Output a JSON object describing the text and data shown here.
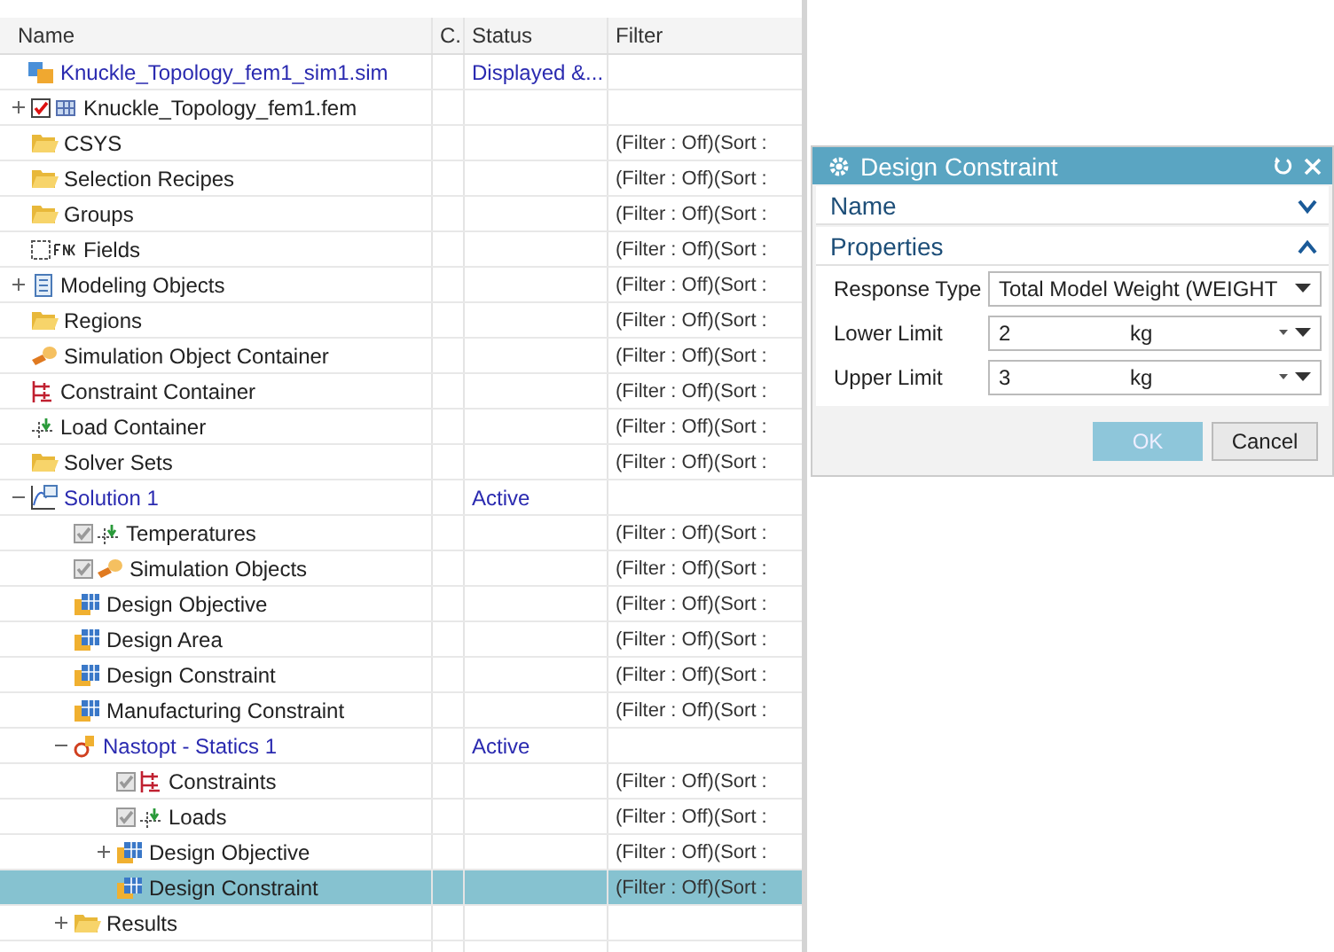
{
  "tree": {
    "columns": [
      "Name",
      "C.",
      "Status",
      "Filter"
    ],
    "nodes": [
      {
        "name": "Knuckle_Topology_fem1_sim1.sim",
        "kind": "sim",
        "status": "Displayed &...",
        "selected": false,
        "children": [
          {
            "name": "Knuckle_Topology_fem1.fem",
            "kind": "fem",
            "expanded": false,
            "checkbox": {
              "checked": true,
              "disabled": false
            },
            "selected": false
          },
          {
            "name": "CSYS",
            "kind": "folder",
            "filter": "(Filter : Off)(Sort :",
            "selected": false
          },
          {
            "name": "Selection Recipes",
            "kind": "folder",
            "filter": "(Filter : Off)(Sort :",
            "selected": false
          },
          {
            "name": "Groups",
            "kind": "folder",
            "filter": "(Filter : Off)(Sort :",
            "selected": false
          },
          {
            "name": "Fields",
            "kind": "fields",
            "checkbox": {
              "checked": false,
              "disabled": false
            },
            "filter": "(Filter : Off)(Sort :",
            "selected": false
          },
          {
            "name": "Modeling Objects",
            "kind": "modeling",
            "expanded": false,
            "filter": "(Filter : Off)(Sort :",
            "selected": false
          },
          {
            "name": "Regions",
            "kind": "folder",
            "filter": "(Filter : Off)(Sort :",
            "selected": false
          },
          {
            "name": "Simulation Object Container",
            "kind": "simobject",
            "filter": "(Filter : Off)(Sort :",
            "selected": false
          },
          {
            "name": "Constraint Container",
            "kind": "constraint",
            "filter": "(Filter : Off)(Sort :",
            "selected": false
          },
          {
            "name": "Load Container",
            "kind": "load",
            "filter": "(Filter : Off)(Sort :",
            "selected": false
          },
          {
            "name": "Solver Sets",
            "kind": "folder",
            "filter": "(Filter : Off)(Sort :",
            "selected": false
          },
          {
            "name": "Solution 1",
            "kind": "solution",
            "expanded": true,
            "status": "Active",
            "selected": false,
            "children": [
              {
                "name": "Temperatures",
                "kind": "load",
                "checkbox": {
                  "checked": true,
                  "disabled": true
                },
                "filter": "(Filter : Off)(Sort :",
                "selected": false
              },
              {
                "name": "Simulation Objects",
                "kind": "simobject",
                "checkbox": {
                  "checked": true,
                  "disabled": true
                },
                "filter": "(Filter : Off)(Sort :",
                "selected": false
              },
              {
                "name": "Design Objective",
                "kind": "design",
                "filter": "(Filter : Off)(Sort :",
                "selected": false
              },
              {
                "name": "Design Area",
                "kind": "design",
                "filter": "(Filter : Off)(Sort :",
                "selected": false
              },
              {
                "name": "Design Constraint",
                "kind": "design",
                "filter": "(Filter : Off)(Sort :",
                "selected": false
              },
              {
                "name": "Manufacturing Constraint",
                "kind": "design",
                "filter": "(Filter : Off)(Sort :",
                "selected": false
              },
              {
                "name": "Nastopt - Statics 1",
                "kind": "nastopt",
                "expanded": true,
                "status": "Active",
                "selected": false,
                "children": [
                  {
                    "name": "Constraints",
                    "kind": "constraint",
                    "checkbox": {
                      "checked": true,
                      "disabled": true
                    },
                    "filter": "(Filter : Off)(Sort :",
                    "selected": false
                  },
                  {
                    "name": "Loads",
                    "kind": "load",
                    "checkbox": {
                      "checked": true,
                      "disabled": true
                    },
                    "filter": "(Filter : Off)(Sort :",
                    "selected": false
                  },
                  {
                    "name": "Design Objective",
                    "kind": "design",
                    "expanded": false,
                    "filter": "(Filter : Off)(Sort :",
                    "selected": false
                  },
                  {
                    "name": "Design Constraint",
                    "kind": "design",
                    "filter": "(Filter : Off)(Sort :",
                    "selected": true
                  }
                ]
              },
              {
                "name": "Results",
                "kind": "folder",
                "expanded": false,
                "selected": false
              }
            ]
          }
        ]
      }
    ]
  },
  "dialog": {
    "title": "Design Constraint",
    "sections": [
      {
        "title": "Name",
        "expanded": false
      },
      {
        "title": "Properties",
        "expanded": true,
        "fields": [
          {
            "kind": "dropdown",
            "label": "Response Type",
            "value": "Total Model Weight (WEIGHT"
          },
          {
            "kind": "unit",
            "label": "Lower Limit",
            "value": "2",
            "unit": "kg"
          },
          {
            "kind": "unit",
            "label": "Upper Limit",
            "value": "3",
            "unit": "kg"
          }
        ]
      }
    ],
    "buttons": [
      {
        "label": "OK",
        "kind": "primary"
      },
      {
        "label": "Cancel",
        "kind": "secondary"
      }
    ]
  }
}
